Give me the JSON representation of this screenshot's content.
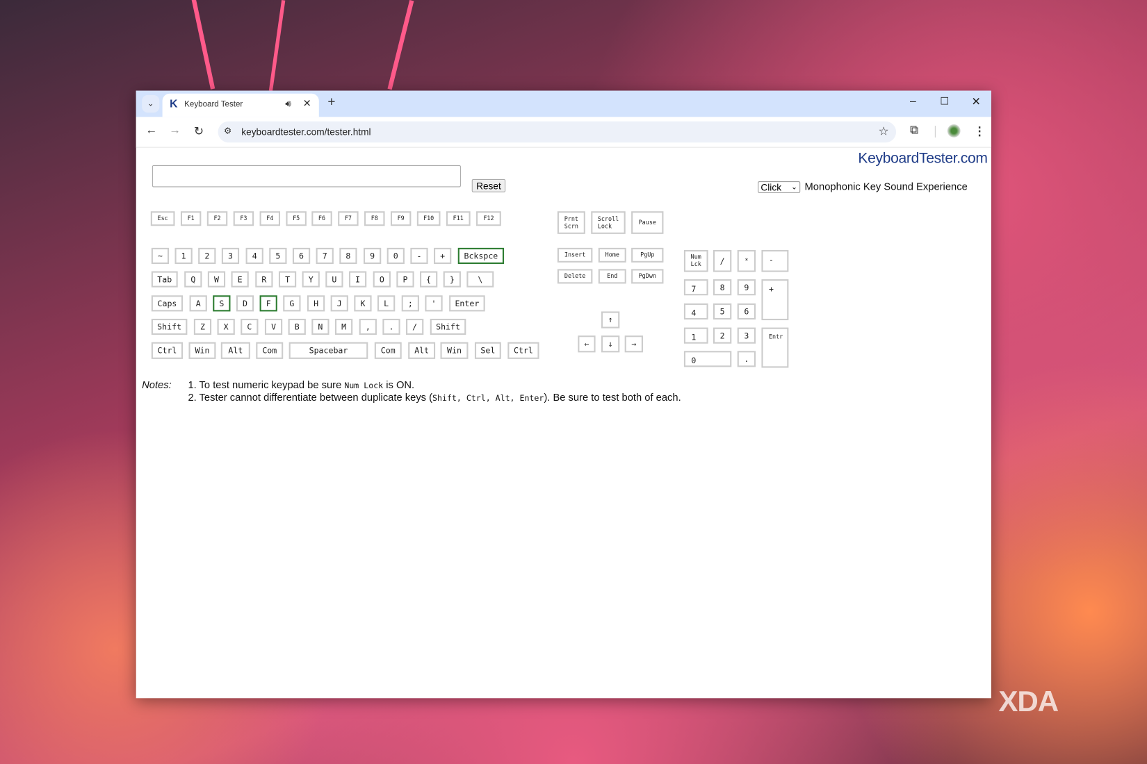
{
  "browser": {
    "tab_title": "Keyboard Tester",
    "tab_favicon": "K",
    "url": "keyboardtester.com/tester.html",
    "new_tab": "+",
    "window_controls": {
      "minimize": "–",
      "maximize": "☐",
      "close": "✕"
    }
  },
  "page": {
    "logo": "KeyboardTester.com",
    "textarea_value": "",
    "reset_label": "Reset",
    "sound_select_value": "Click",
    "sound_label": "Monophonic Key Sound Experience",
    "highlight_color": "#2e7d32"
  },
  "keyboard": {
    "function_row": [
      "Esc",
      "F1",
      "F2",
      "F3",
      "F4",
      "F5",
      "F6",
      "F7",
      "F8",
      "F9",
      "F10",
      "F11",
      "F12"
    ],
    "rows": [
      [
        {
          "label": "~"
        },
        {
          "label": "1"
        },
        {
          "label": "2"
        },
        {
          "label": "3"
        },
        {
          "label": "4"
        },
        {
          "label": "5"
        },
        {
          "label": "6"
        },
        {
          "label": "7"
        },
        {
          "label": "8"
        },
        {
          "label": "9"
        },
        {
          "label": "0"
        },
        {
          "label": "-"
        },
        {
          "label": "+"
        },
        {
          "label": "Bckspce",
          "pressed": true
        }
      ],
      [
        {
          "label": "Tab"
        },
        {
          "label": "Q"
        },
        {
          "label": "W"
        },
        {
          "label": "E"
        },
        {
          "label": "R"
        },
        {
          "label": "T"
        },
        {
          "label": "Y"
        },
        {
          "label": "U"
        },
        {
          "label": "I"
        },
        {
          "label": "O"
        },
        {
          "label": "P"
        },
        {
          "label": "{"
        },
        {
          "label": "}"
        },
        {
          "label": "\\"
        }
      ],
      [
        {
          "label": "Caps"
        },
        {
          "label": "A"
        },
        {
          "label": "S",
          "pressed": true
        },
        {
          "label": "D"
        },
        {
          "label": "F",
          "pressed": true
        },
        {
          "label": "G"
        },
        {
          "label": "H"
        },
        {
          "label": "J"
        },
        {
          "label": "K"
        },
        {
          "label": "L"
        },
        {
          "label": ";"
        },
        {
          "label": "'"
        },
        {
          "label": "Enter"
        }
      ],
      [
        {
          "label": "Shift"
        },
        {
          "label": "Z"
        },
        {
          "label": "X"
        },
        {
          "label": "C"
        },
        {
          "label": "V"
        },
        {
          "label": "B"
        },
        {
          "label": "N"
        },
        {
          "label": "M"
        },
        {
          "label": ","
        },
        {
          "label": "."
        },
        {
          "label": "/"
        },
        {
          "label": "Shift"
        }
      ],
      [
        {
          "label": "Ctrl"
        },
        {
          "label": "Win"
        },
        {
          "label": "Alt"
        },
        {
          "label": "Com"
        },
        {
          "label": "Spacebar"
        },
        {
          "label": "Com"
        },
        {
          "label": "Alt"
        },
        {
          "label": "Win"
        },
        {
          "label": "Sel"
        },
        {
          "label": "Ctrl"
        }
      ]
    ],
    "system_keys": [
      "Prnt\nScrn",
      "Scroll\nLock",
      "Pause"
    ],
    "nav_keys": [
      "Insert",
      "Home",
      "PgUp",
      "Delete",
      "End",
      "PgDwn"
    ],
    "arrow_keys": [
      "↑",
      "←",
      "↓",
      "→"
    ],
    "numpad": [
      "Num\nLck",
      "/",
      "*",
      "-",
      "7",
      "8",
      "9",
      "+",
      "4",
      "5",
      "6",
      "1",
      "2",
      "3",
      "Entr",
      "0",
      "."
    ]
  },
  "notes": {
    "label": "Notes:",
    "line1_pre": "1. To test numeric keypad be sure ",
    "line1_code": "Num Lock",
    "line1_post": " is ON.",
    "line2_pre": "2. Tester cannot differentiate between duplicate keys (",
    "line2_code": "Shift, Ctrl, Alt, Enter",
    "line2_post": "). Be sure to test both of each."
  },
  "watermark": "XDA"
}
